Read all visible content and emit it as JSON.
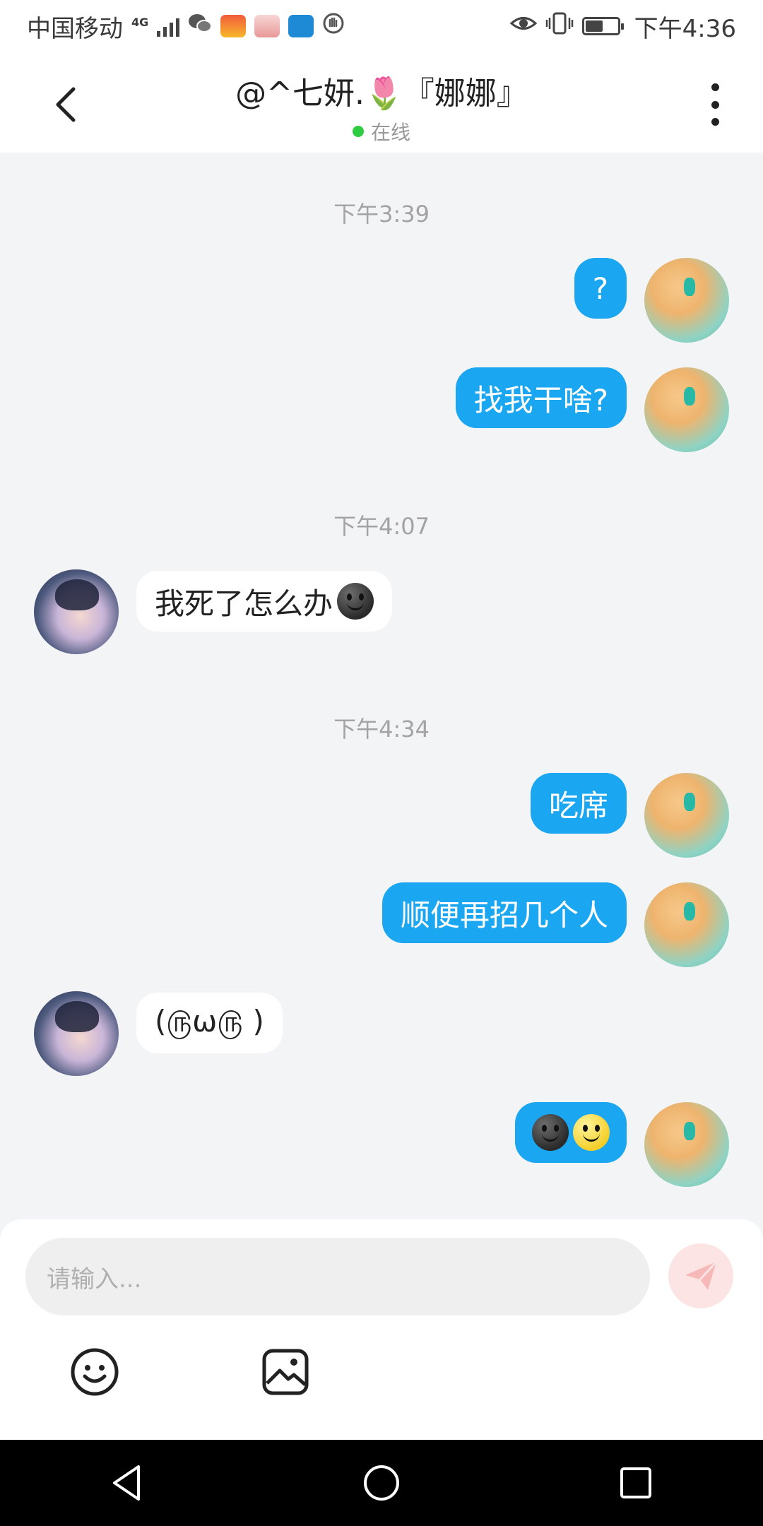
{
  "status_bar": {
    "carrier": "中国移动",
    "network": "4G",
    "time": "下午4:36",
    "battery_level": 0.55
  },
  "header": {
    "title": "@^七妍.🌷『娜娜』",
    "status": "在线",
    "back_icon": "chevron-left-icon",
    "more_icon": "more-vertical-icon"
  },
  "messages": [
    {
      "type": "time",
      "text": "下午3:39"
    },
    {
      "type": "msg",
      "from": "me",
      "text": "?"
    },
    {
      "type": "msg",
      "from": "me",
      "text": "找我干啥?"
    },
    {
      "type": "time",
      "text": "下午4:07"
    },
    {
      "type": "msg",
      "from": "her",
      "text": "我死了怎么办",
      "emoji": "dark-smiley-emoji"
    },
    {
      "type": "time",
      "text": "下午4:34"
    },
    {
      "type": "msg",
      "from": "me",
      "text": "吃席"
    },
    {
      "type": "msg",
      "from": "me",
      "text": "顺便再招几个人"
    },
    {
      "type": "msg",
      "from": "her",
      "text": "(௫ω௫ )"
    },
    {
      "type": "msg",
      "from": "me",
      "text": "",
      "emojis": [
        "dark-smiley-emoji",
        "yellow-smiley-emoji"
      ]
    }
  ],
  "input": {
    "placeholder": "请输入...",
    "send_icon": "paper-plane-icon",
    "emoji_icon": "smiley-icon",
    "image_icon": "image-icon"
  },
  "navbar": {
    "back_icon": "triangle-back-icon",
    "home_icon": "circle-home-icon",
    "recents_icon": "square-recents-icon"
  },
  "colors": {
    "my_bubble": "#1aa6f0",
    "her_bubble": "#ffffff",
    "background": "#f3f4f6",
    "online_dot": "#2ecc40"
  }
}
